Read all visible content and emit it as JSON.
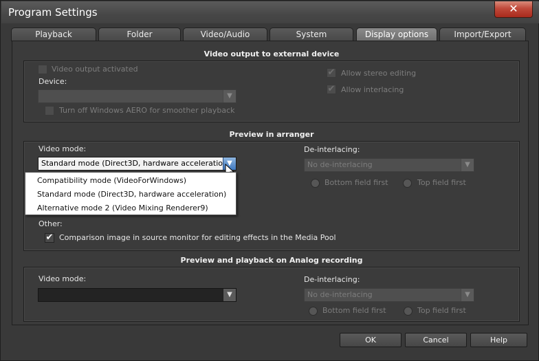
{
  "window": {
    "title": "Program Settings",
    "close_label": "✕"
  },
  "tabs": [
    {
      "label": "Playback"
    },
    {
      "label": "Folder"
    },
    {
      "label": "Video/Audio"
    },
    {
      "label": "System"
    },
    {
      "label": "Display options",
      "active": true
    },
    {
      "label": "Import/Export"
    }
  ],
  "external": {
    "title": "Video output to external device",
    "video_output_label": "Video output activated",
    "video_output_checked": false,
    "device_label": "Device:",
    "device_value": "",
    "aero_label": "Turn off Windows AERO for smoother playback",
    "aero_checked": false,
    "stereo_label": "Allow stereo editing",
    "stereo_checked": true,
    "interlacing_label": "Allow interlacing",
    "interlacing_checked": true
  },
  "arranger": {
    "title": "Preview in arranger",
    "video_mode_label": "Video mode:",
    "video_mode_value": "Standard mode (Direct3D, hardware acceleration)",
    "video_mode_options": [
      "Compatibility mode (VideoForWindows)",
      "Standard mode (Direct3D, hardware acceleration)",
      "Alternative mode 2 (Video Mixing Renderer9)"
    ],
    "deinterlacing_label": "De-interlacing:",
    "deinterlacing_value": "No de-interlacing",
    "bottom_field_label": "Bottom field first",
    "top_field_label": "Top field first",
    "other_label": "Other:",
    "comparison_label": "Comparison image in source monitor for editing effects in the Media Pool",
    "comparison_checked": true
  },
  "analog": {
    "title": "Preview and playback on Analog recording",
    "video_mode_label": "Video mode:",
    "video_mode_value": "",
    "deinterlacing_label": "De-interlacing:",
    "deinterlacing_value": "No de-interlacing",
    "bottom_field_label": "Bottom field first",
    "top_field_label": "Top field first"
  },
  "buttons": {
    "ok": "OK",
    "cancel": "Cancel",
    "help": "Help"
  },
  "icons": {
    "dropdown_arrow": "▼",
    "checkmark": "✔"
  },
  "colors": {
    "background": "#393939",
    "dropdown_highlight": "#3e78c0",
    "close_button": "#c0493a"
  }
}
